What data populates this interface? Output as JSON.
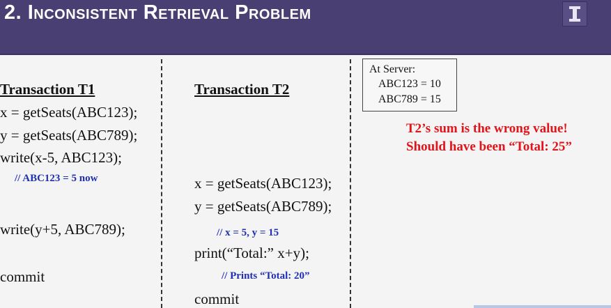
{
  "slide": {
    "title": "2. Inconsistent Retrieval Problem"
  },
  "t1": {
    "heading": "Transaction T1",
    "line1": "x = getSeats(ABC123);",
    "line2": "y = getSeats(ABC789);",
    "line3": "write(x-5, ABC123);",
    "comment1": "// ABC123 = 5 now",
    "line4": "write(y+5, ABC789);",
    "line5": "commit"
  },
  "t2": {
    "heading": "Transaction T2",
    "line1": "x = getSeats(ABC123);",
    "line2": "y = getSeats(ABC789);",
    "comment1": "// x = 5, y = 15",
    "line3": "print(“Total:” x+y);",
    "comment2": "// Prints “Total: 20”",
    "line4": "commit"
  },
  "server": {
    "label": "At Server:",
    "value1": "ABC123 = 10",
    "value2": "ABC789 = 15"
  },
  "note": {
    "line1": "T2’s sum is the wrong value!",
    "line2": "Should have been “Total: 25”"
  },
  "colors": {
    "header_bg": "#4a3f73",
    "comment": "#1f2fb3",
    "note": "#e0141a"
  }
}
